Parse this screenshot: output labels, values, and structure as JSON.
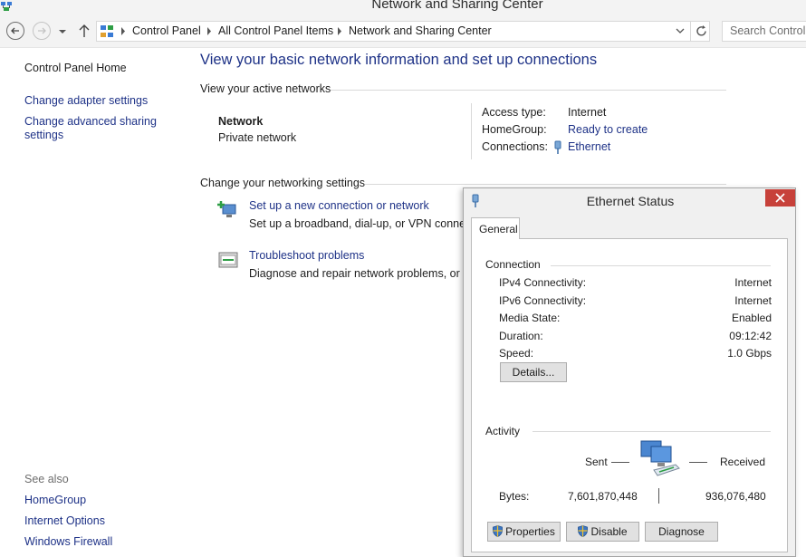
{
  "window": {
    "title": "Network and Sharing Center"
  },
  "address_bar": {
    "breadcrumbs": [
      "Control Panel",
      "All Control Panel Items",
      "Network and Sharing Center"
    ],
    "search_placeholder": "Search Control Panel"
  },
  "left_pane": {
    "home": "Control Panel Home",
    "links": [
      "Change adapter settings",
      "Change advanced sharing settings"
    ],
    "see_also_label": "See also",
    "see_also": [
      "HomeGroup",
      "Internet Options",
      "Windows Firewall"
    ]
  },
  "main": {
    "heading": "View your basic network information and set up connections",
    "active_networks_label": "View your active networks",
    "network": {
      "name": "Network",
      "type": "Private network",
      "access_type_label": "Access type:",
      "access_type": "Internet",
      "homegroup_label": "HomeGroup:",
      "homegroup": "Ready to create",
      "connections_label": "Connections:",
      "connection": "Ethernet"
    },
    "change_settings_label": "Change your networking settings",
    "options": [
      {
        "title": "Set up a new connection or network",
        "description": "Set up a broadband, dial-up, or VPN connection; or set up a router or access point."
      },
      {
        "title": "Troubleshoot problems",
        "description": "Diagnose and repair network problems, or get troubleshooting information."
      }
    ]
  },
  "dialog": {
    "title": "Ethernet Status",
    "tab": "General",
    "connection_group": "Connection",
    "rows": [
      {
        "label": "IPv4 Connectivity:",
        "value": "Internet"
      },
      {
        "label": "IPv6 Connectivity:",
        "value": "Internet"
      },
      {
        "label": "Media State:",
        "value": "Enabled"
      },
      {
        "label": "Duration:",
        "value": "09:12:42"
      },
      {
        "label": "Speed:",
        "value": "1.0 Gbps"
      }
    ],
    "details_button": "Details...",
    "activity_group": "Activity",
    "sent_label": "Sent",
    "received_label": "Received",
    "bytes_label": "Bytes:",
    "bytes_sent": "7,601,870,448",
    "bytes_received": "936,076,480",
    "buttons": {
      "properties": "Properties",
      "disable": "Disable",
      "diagnose": "Diagnose"
    }
  },
  "colors": {
    "link": "#1e3287",
    "close": "#c7413a",
    "chrome": "#f3f3f3"
  }
}
